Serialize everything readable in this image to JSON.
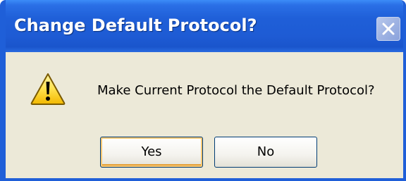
{
  "dialog": {
    "title": "Change Default Protocol?",
    "message": "Make Current Protocol the Default Protocol?",
    "icon": "warning-icon",
    "close_icon": "close-icon",
    "buttons": {
      "yes_label": "Yes",
      "no_label": "No"
    }
  },
  "colors": {
    "titlebar": "#1f5fd8",
    "client_background": "#ece9d8",
    "default_button_highlight": "#f7c873"
  }
}
